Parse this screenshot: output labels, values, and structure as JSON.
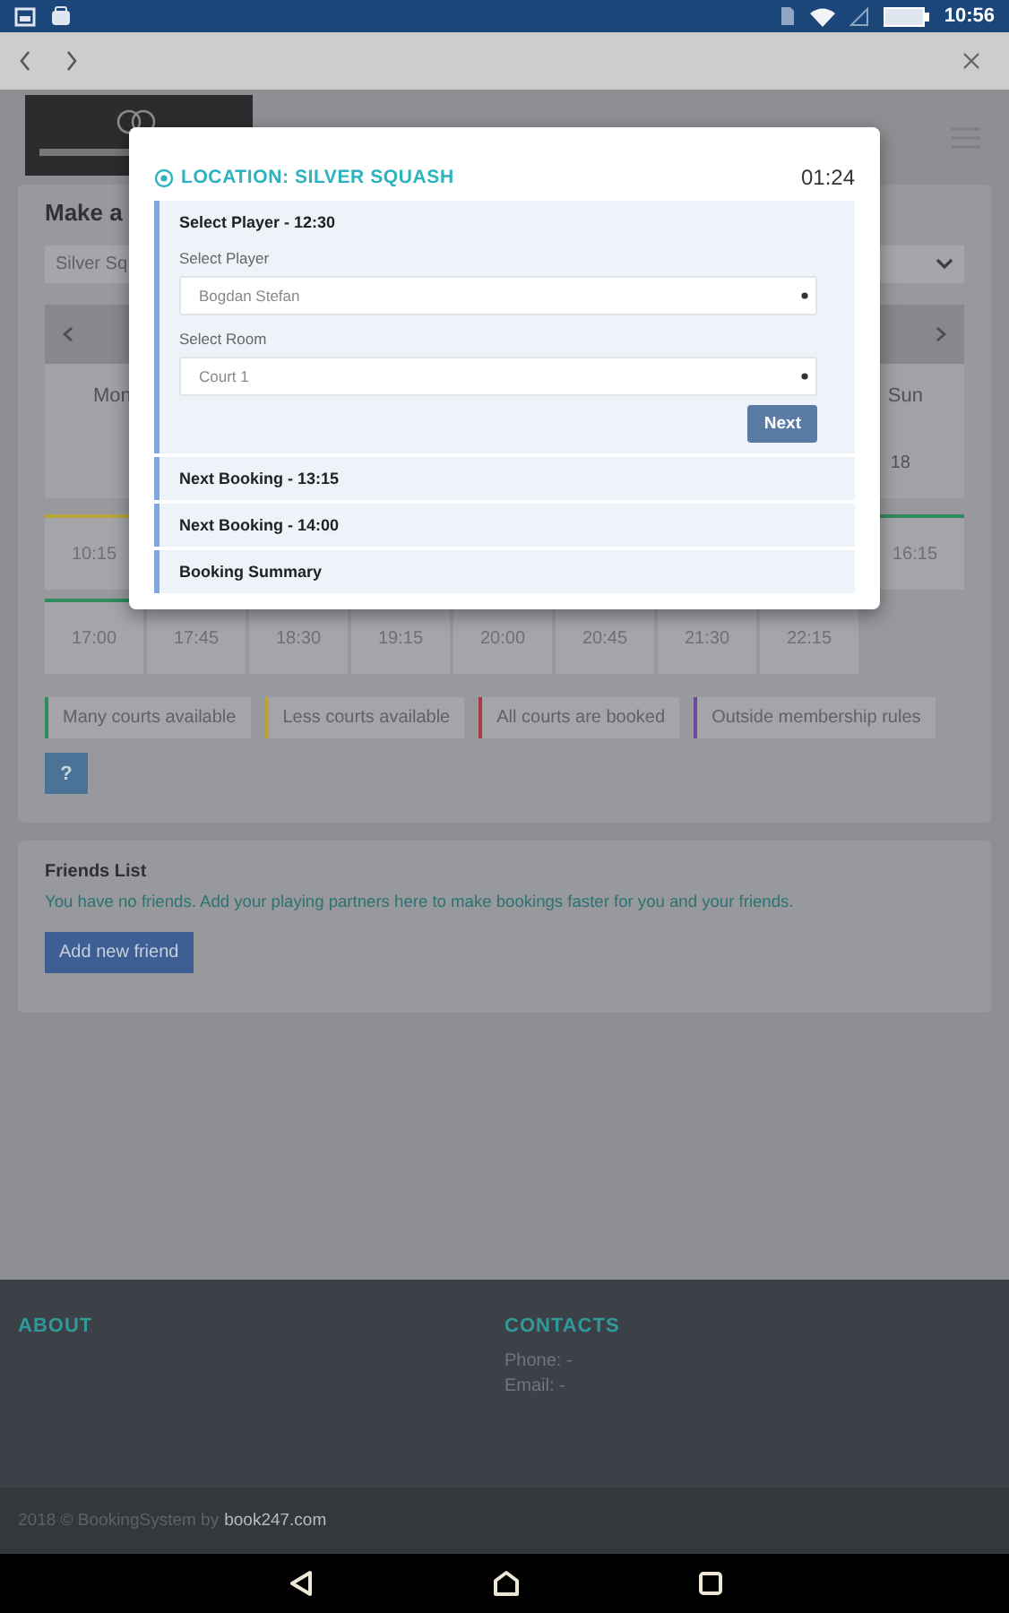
{
  "status_bar": {
    "time": "10:56"
  },
  "booking": {
    "title": "Make a",
    "venue_select": "Silver Sq",
    "days": [
      "Mon",
      "Sun"
    ],
    "dates": [
      "18"
    ],
    "slot_rows": [
      [
        {
          "time": "10:15",
          "color": "#b8a43a"
        },
        {
          "time": "16:15",
          "color": "#2f8a5c"
        }
      ],
      [
        {
          "time": "17:00",
          "color": "#2f8a5c"
        },
        {
          "time": "17:45"
        },
        {
          "time": "18:30"
        },
        {
          "time": "19:15"
        },
        {
          "time": "20:00"
        },
        {
          "time": "20:45"
        },
        {
          "time": "21:30"
        },
        {
          "time": "22:15"
        }
      ]
    ],
    "legend": [
      {
        "label": "Many courts available",
        "color": "#2f8a5c"
      },
      {
        "label": "Less courts available",
        "color": "#b8a43a"
      },
      {
        "label": "All courts are booked",
        "color": "#a83a44"
      },
      {
        "label": "Outside membership rules",
        "color": "#6a4a9a"
      }
    ],
    "help_button": "?"
  },
  "friends": {
    "title": "Friends List",
    "message": "You have no friends. Add your playing partners here to make bookings faster for you and your friends.",
    "add_button": "Add new friend"
  },
  "modal": {
    "title": "LOCATION: SILVER SQUASH",
    "timer": "01:24",
    "sections": [
      {
        "title": "Select Player - 12:30",
        "expanded": true,
        "fields": [
          {
            "label": "Select Player",
            "value": "Bogdan Stefan"
          },
          {
            "label": "Select Room",
            "value": "Court 1"
          }
        ],
        "button": "Next"
      },
      {
        "title": "Next Booking - 13:15",
        "expanded": false
      },
      {
        "title": "Next Booking - 14:00",
        "expanded": false
      },
      {
        "title": "Booking Summary",
        "expanded": false
      }
    ]
  },
  "footer": {
    "about_title": "ABOUT",
    "contacts_title": "CONTACTS",
    "phone": "Phone: -",
    "email": "Email: -",
    "copyright": "2018 © BookingSystem by",
    "link": "book247.com"
  }
}
